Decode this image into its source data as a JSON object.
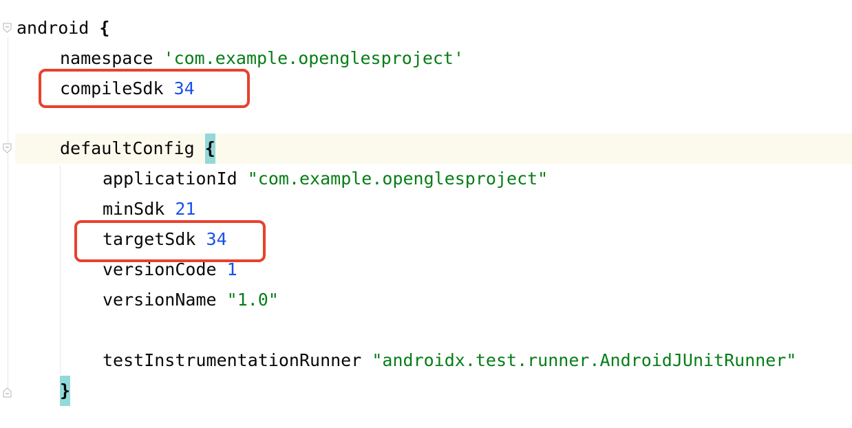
{
  "lines": [
    {
      "indent": 0,
      "key": "android",
      "brace": "{"
    },
    {
      "indent": 1,
      "key": "namespace",
      "value": "'com.example.openglesproject'",
      "value_type": "string"
    },
    {
      "indent": 1,
      "key": "compileSdk",
      "value": "34",
      "value_type": "number"
    },
    {
      "indent": 1,
      "key": "defaultConfig",
      "brace": "{"
    },
    {
      "indent": 2,
      "key": "applicationId",
      "value": "\"com.example.openglesproject\"",
      "value_type": "string"
    },
    {
      "indent": 2,
      "key": "minSdk",
      "value": "21",
      "value_type": "number"
    },
    {
      "indent": 2,
      "key": "targetSdk",
      "value": "34",
      "value_type": "number"
    },
    {
      "indent": 2,
      "key": "versionCode",
      "value": "1",
      "value_type": "number"
    },
    {
      "indent": 2,
      "key": "versionName",
      "value": "\"1.0\"",
      "value_type": "string"
    },
    {
      "indent": 2,
      "key": "testInstrumentationRunner",
      "value": "\"androidx.test.runner.AndroidJUnitRunner\"",
      "value_type": "string"
    },
    {
      "indent": 1,
      "brace": "}"
    }
  ],
  "colors": {
    "plain": "#080808",
    "string": "#067d17",
    "number": "#1750eb",
    "highlight_box": "#e8412c",
    "brace_match_bg": "#93d9d9",
    "current_line_bg": "#fcfaed"
  },
  "highlighted": [
    "compileSdk",
    "targetSdk"
  ]
}
